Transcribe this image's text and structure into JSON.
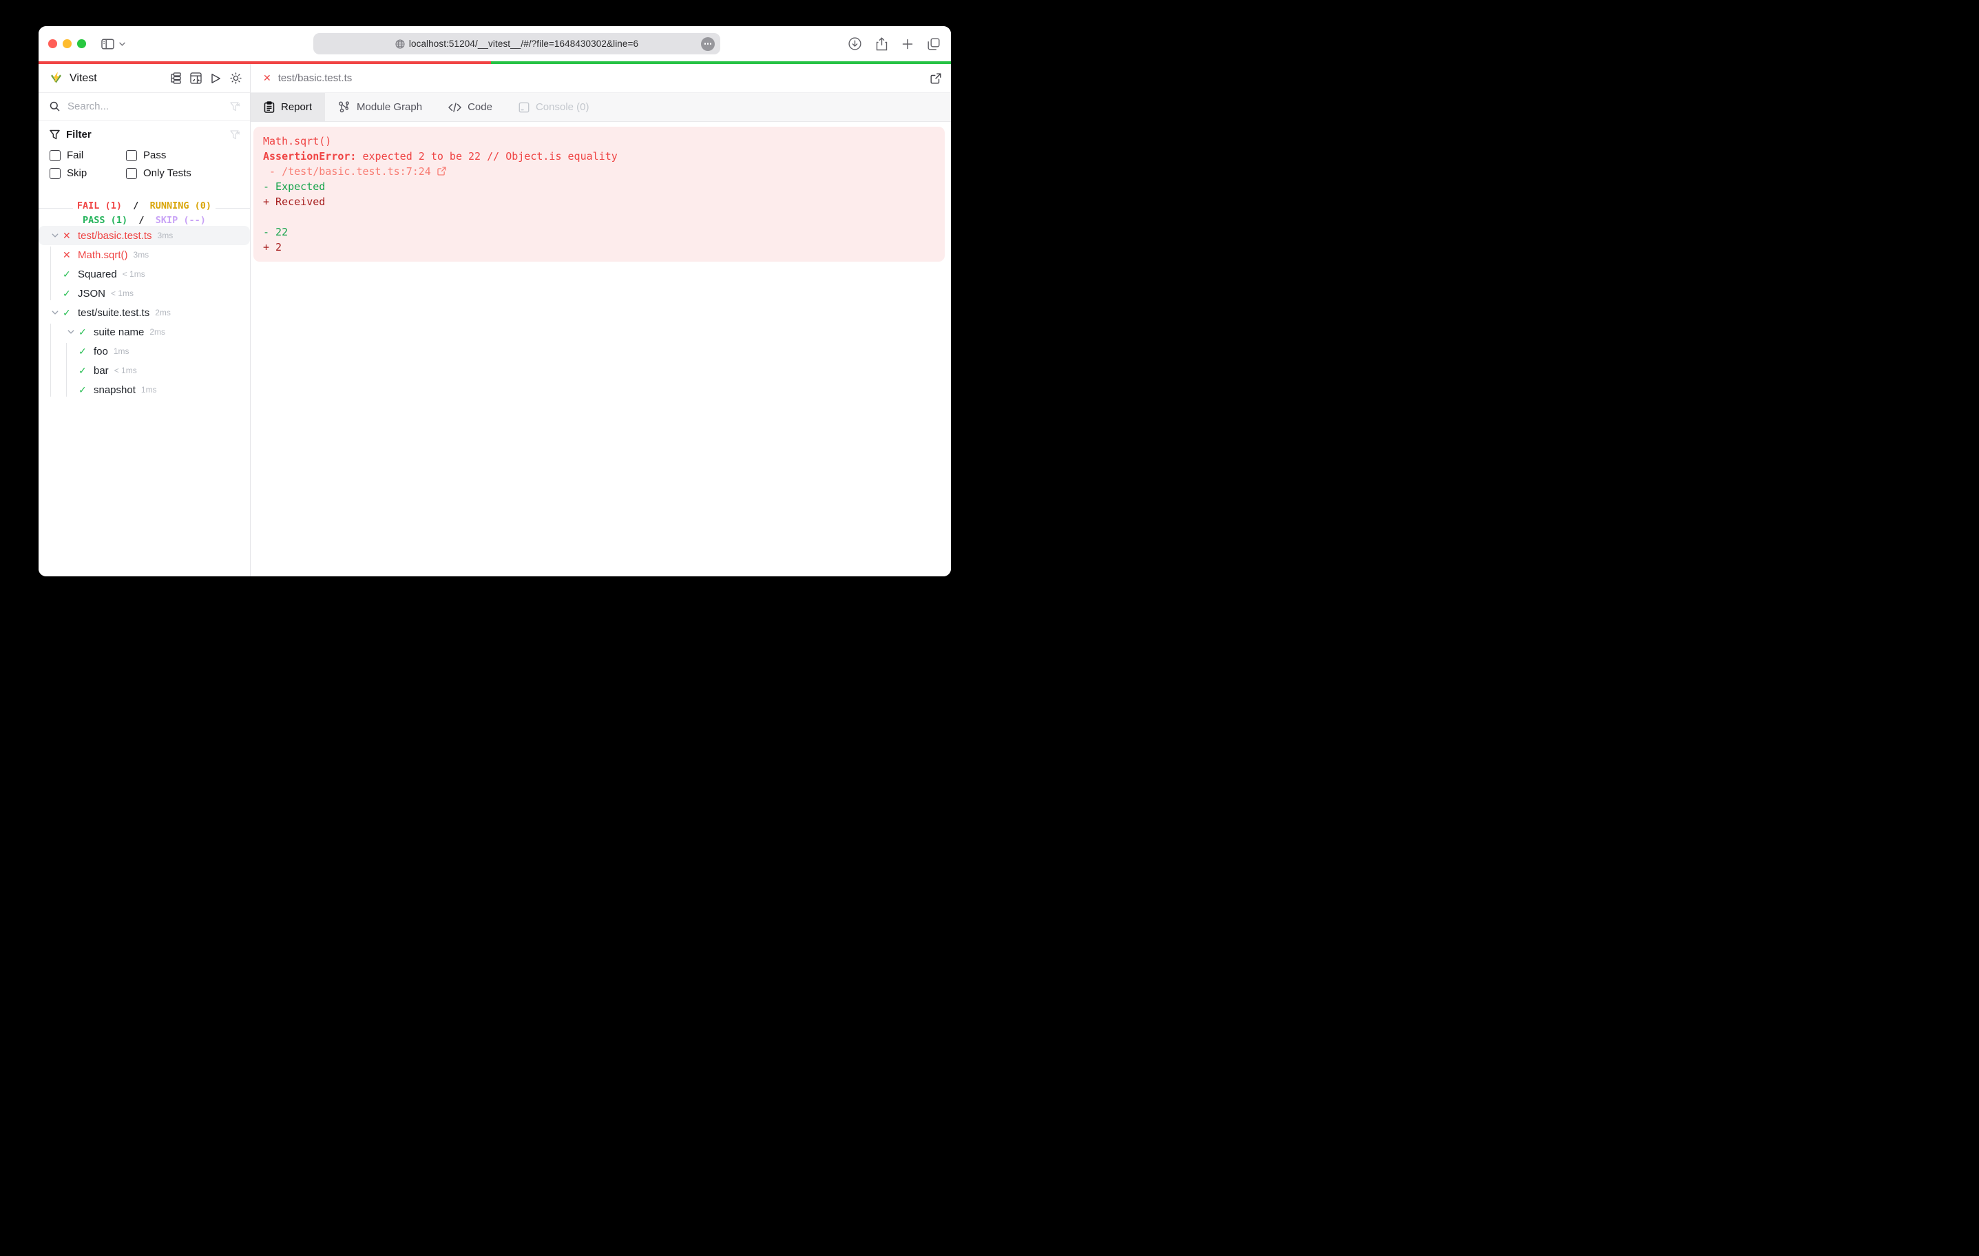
{
  "browser": {
    "url": "localhost:51204/__vitest__/#/?file=1648430302&line=6",
    "toolbar_icons": [
      "sidebar-toggle-icon",
      "chevron-down-icon",
      "globe-icon",
      "ellipsis-icon",
      "download-icon",
      "share-icon",
      "new-tab-icon",
      "tab-overview-icon"
    ]
  },
  "progress": {
    "fail_percent": 49.6,
    "pass_percent": 50.4
  },
  "colors": {
    "fail": "#ef4444",
    "pass": "#23b35a",
    "running": "#d9a50a",
    "skip": "#c8a2f6",
    "progress_fail": "#f04444",
    "progress_pass": "#26c245",
    "error_background": "#fdecec",
    "diff_expected": "#15a34a",
    "diff_received": "#a61d1d"
  },
  "sidebar": {
    "title": "Vitest",
    "header_icons": [
      "tree-view-icon",
      "dashboard-icon",
      "run-all-icon",
      "theme-toggle-icon"
    ],
    "search": {
      "placeholder": "Search...",
      "value": ""
    },
    "filter": {
      "label": "Filter",
      "options": [
        {
          "label": "Fail",
          "checked": false
        },
        {
          "label": "Pass",
          "checked": false
        },
        {
          "label": "Skip",
          "checked": false
        },
        {
          "label": "Only Tests",
          "checked": false
        }
      ]
    },
    "summary": {
      "fail": "FAIL (1)",
      "running": "RUNNING (0)",
      "pass": "PASS (1)",
      "skip": "SKIP (--)",
      "separator": "/"
    },
    "tree": [
      {
        "name": "test/basic.test.ts",
        "status": "fail",
        "duration": "3ms",
        "level": 0,
        "chevron": true,
        "selected": true
      },
      {
        "name": "Math.sqrt()",
        "status": "fail",
        "duration": "3ms",
        "level": 1,
        "chevron": false,
        "selected": false
      },
      {
        "name": "Squared",
        "status": "pass",
        "duration": "< 1ms",
        "level": 1,
        "chevron": false,
        "selected": false
      },
      {
        "name": "JSON",
        "status": "pass",
        "duration": "< 1ms",
        "level": 1,
        "chevron": false,
        "selected": false
      },
      {
        "name": "test/suite.test.ts",
        "status": "pass",
        "duration": "2ms",
        "level": 0,
        "chevron": true,
        "selected": false
      },
      {
        "name": "suite name",
        "status": "pass",
        "duration": "2ms",
        "level": 1,
        "chevron": true,
        "selected": false
      },
      {
        "name": "foo",
        "status": "pass",
        "duration": "1ms",
        "level": 2,
        "chevron": false,
        "selected": false
      },
      {
        "name": "bar",
        "status": "pass",
        "duration": "< 1ms",
        "level": 2,
        "chevron": false,
        "selected": false
      },
      {
        "name": "snapshot",
        "status": "pass",
        "duration": "1ms",
        "level": 2,
        "chevron": false,
        "selected": false
      }
    ]
  },
  "main": {
    "file_tab": {
      "status_icon": "✕",
      "name": "test/basic.test.ts"
    },
    "tabs": [
      {
        "label": "Report",
        "icon": "report-icon",
        "active": true,
        "disabled": false
      },
      {
        "label": "Module Graph",
        "icon": "module-graph-icon",
        "active": false,
        "disabled": false
      },
      {
        "label": "Code",
        "icon": "code-icon",
        "active": false,
        "disabled": false
      },
      {
        "label": "Console (0)",
        "icon": "console-icon",
        "active": false,
        "disabled": true
      }
    ],
    "report_lines": [
      [
        {
          "t": "Math.sqrt()",
          "s": "red"
        }
      ],
      [
        {
          "t": "AssertionError: ",
          "s": "red-bold"
        },
        {
          "t": "expected 2 to be 22 // Object.is equality",
          "s": "red"
        }
      ],
      [
        {
          "t": " - /test/basic.test.ts:7:24 ",
          "s": "salmon",
          "icon": "external-link-icon",
          "link": true
        }
      ],
      [
        {
          "t": "- Expected",
          "s": "green"
        }
      ],
      [
        {
          "t": "+ Received",
          "s": "darkred"
        }
      ],
      [],
      [
        {
          "t": "- 22",
          "s": "green"
        }
      ],
      [
        {
          "t": "+ 2",
          "s": "darkred"
        }
      ]
    ]
  }
}
